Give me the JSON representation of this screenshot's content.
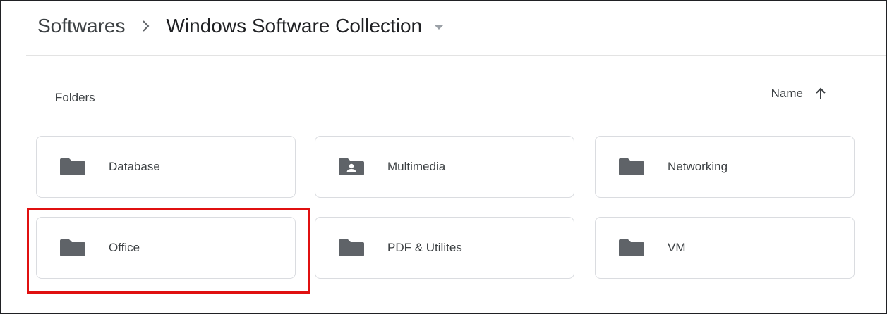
{
  "breadcrumb": {
    "root": "Softwares",
    "current": "Windows Software Collection"
  },
  "section": {
    "label": "Folders"
  },
  "sort": {
    "label": "Name",
    "direction": "ascending"
  },
  "folders": [
    {
      "name": "Database",
      "icon": "folder-icon"
    },
    {
      "name": "Multimedia",
      "icon": "shared-folder-icon"
    },
    {
      "name": "Networking",
      "icon": "folder-icon"
    },
    {
      "name": "Office",
      "icon": "folder-icon"
    },
    {
      "name": "PDF & Utilites",
      "icon": "folder-icon"
    },
    {
      "name": "VM",
      "icon": "folder-icon"
    }
  ],
  "colors": {
    "highlight": "#e01010",
    "icon": "#5f6368",
    "card_border": "#dadce0"
  }
}
